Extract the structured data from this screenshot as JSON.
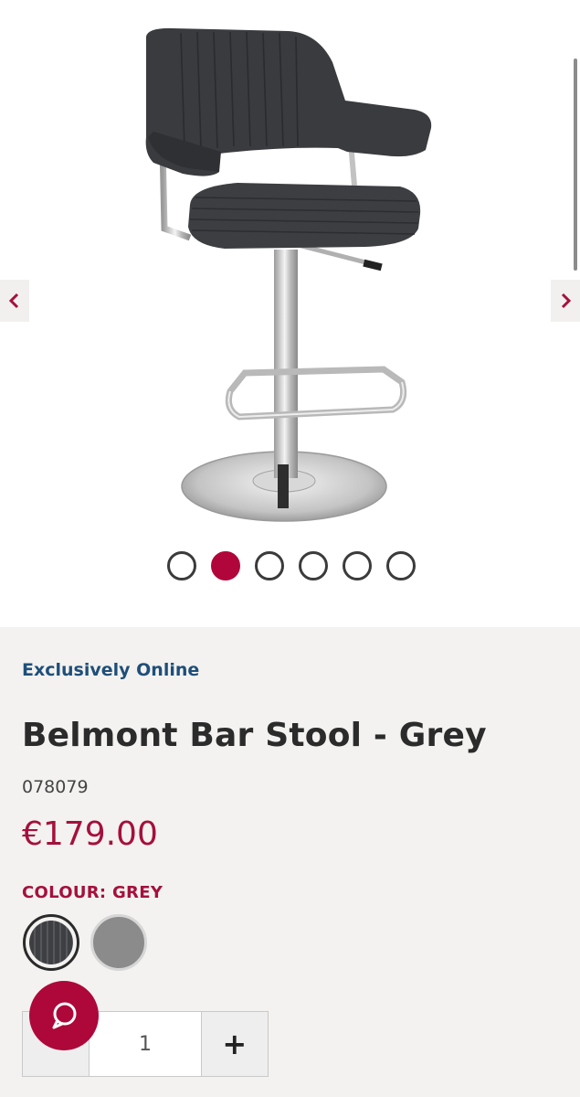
{
  "gallery": {
    "image_alt": "Belmont Bar Stool - Grey",
    "prev_icon": "chevron-left-icon",
    "next_icon": "chevron-right-icon",
    "dot_count": 6,
    "active_dot_index": 1
  },
  "product": {
    "badge": "Exclusively Online",
    "title": "Belmont Bar Stool - Grey",
    "sku": "078079",
    "price": "€179.00",
    "colour_label": "COLOUR: GREY",
    "swatches": [
      "grey-leather",
      "light-grey"
    ]
  },
  "quantity": {
    "value": "1",
    "plus_label": "+"
  },
  "chat": {
    "icon": "chat-bubble-icon"
  },
  "colors": {
    "accent": "#b1063b",
    "link_blue": "#1f4e79",
    "panel_bg": "#f3f2f0"
  }
}
